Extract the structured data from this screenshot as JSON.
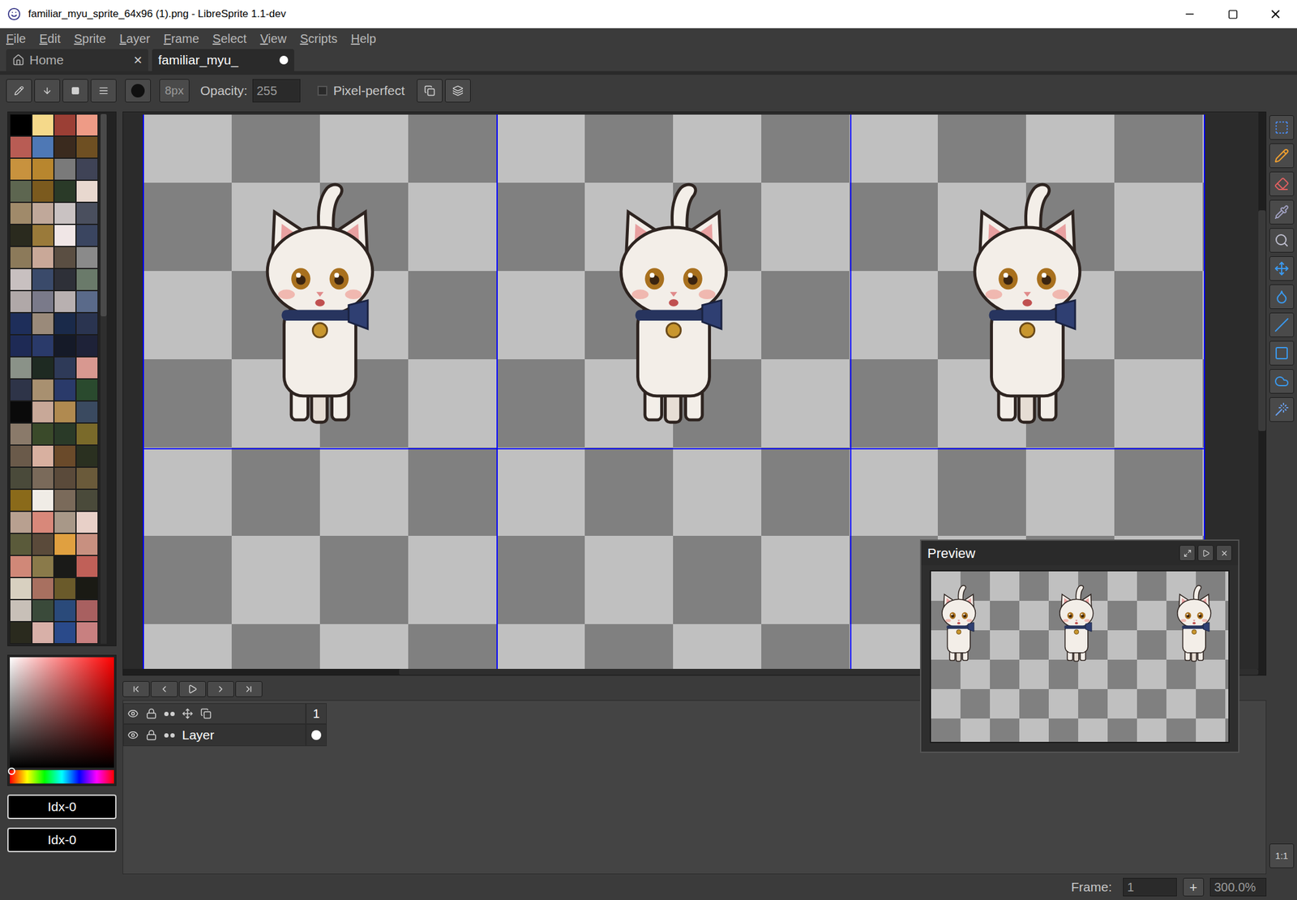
{
  "window": {
    "title": "familiar_myu_sprite_64x96 (1).png - LibreSprite 1.1-dev"
  },
  "menu": [
    "File",
    "Edit",
    "Sprite",
    "Layer",
    "Frame",
    "Select",
    "View",
    "Scripts",
    "Help"
  ],
  "tabs": [
    {
      "label": "Home",
      "selected": false,
      "modified": false,
      "close": "×"
    },
    {
      "label": "familiar_myu_",
      "selected": true,
      "modified": true,
      "close": ""
    }
  ],
  "toolbar": {
    "brush_size": "8px",
    "opacity_label": "Opacity:",
    "opacity": "255",
    "pixel_perfect": {
      "label": "Pixel-perfect",
      "checked": false
    }
  },
  "palette": [
    "#000000",
    "#f5d98a",
    "#9b3f35",
    "#ee9b86",
    "#b85c54",
    "#4e78b5",
    "#3a2a1e",
    "#6e4f22",
    "#c8923e",
    "#b8862e",
    "#7a7a7a",
    "#3f4356",
    "#5d6650",
    "#7b5a1e",
    "#2a3a28",
    "#e8d8cf",
    "#a08a6a",
    "#c0a89a",
    "#c9c2c2",
    "#4a4f5e",
    "#2a2a1e",
    "#9a7a3a",
    "#f0e6e6",
    "#3a4560",
    "#8c7a5a",
    "#c9a898",
    "#5a4e42",
    "#8a8a8a",
    "#c8c0c0",
    "#3a4a6a",
    "#2e3038",
    "#6a7a6a",
    "#b0a8a8",
    "#7a7a8a",
    "#b8b0b0",
    "#5a6a8a",
    "#1e2e5a",
    "#9a8a7a",
    "#1a2a4a",
    "#2a3450",
    "#1e2a55",
    "#2a3a6a",
    "#151a28",
    "#1e2238",
    "#8a9288",
    "#1e2a22",
    "#2e3a58",
    "#d89890",
    "#2e3448",
    "#a89070",
    "#2a3a6a",
    "#2a4a2e",
    "#0a0a0a",
    "#c8a898",
    "#b08a50",
    "#3a4a60",
    "#8a7a6a",
    "#3a4a2a",
    "#2a3a28",
    "#7a6a2a",
    "#6a5a4a",
    "#d8b0a0",
    "#6a4a2a",
    "#2a3020",
    "#4a4a3a",
    "#7a6a5a",
    "#5a4a3a",
    "#6a5a3a",
    "#8a6a1a",
    "#f0ece6",
    "#7a6a5a",
    "#4a4a3a",
    "#b8a090",
    "#d8887a",
    "#a89888",
    "#e8d0c8",
    "#5a5a3a",
    "#5a4a3a",
    "#e0a040",
    "#c89080",
    "#d08878",
    "#8a7a4a",
    "#1a1a18",
    "#c06058",
    "#d8d0c0",
    "#a87060",
    "#6a5a2a",
    "#1a1a14",
    "#c8c0b8",
    "#3a4a3a",
    "#2a4a7a",
    "#a86060",
    "#2a2a1e",
    "#d8b0a8",
    "#2a4a8a",
    "#c88080"
  ],
  "color_fields": [
    "Idx-0",
    "Idx-0"
  ],
  "timeline": {
    "frames": [
      "1"
    ],
    "layers": [
      {
        "name": "Layer",
        "cel": true
      }
    ]
  },
  "preview": {
    "title": "Preview"
  },
  "zoom_button": "1:1",
  "status_bar": {
    "frame_label": "Frame:",
    "frame": "1",
    "add": "+",
    "zoom": "300.0%"
  }
}
